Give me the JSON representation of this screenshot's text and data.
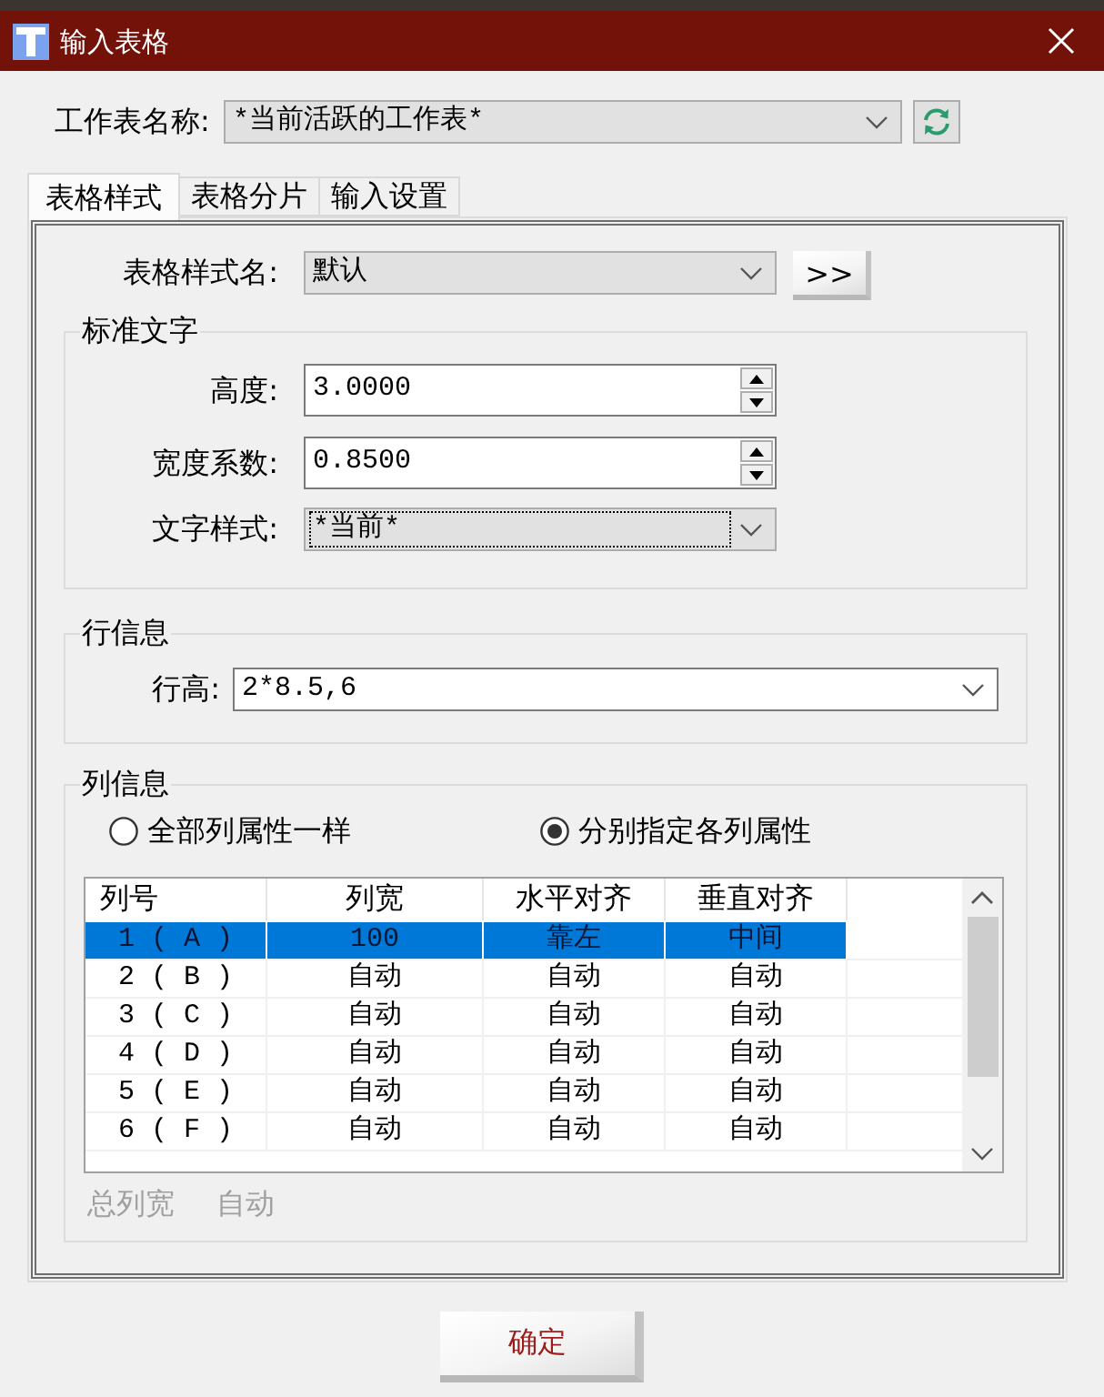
{
  "window": {
    "title": "输入表格"
  },
  "worksheet": {
    "label": "工作表名称:",
    "value": "*当前活跃的工作表*"
  },
  "tabs": [
    {
      "label": "表格样式",
      "selected": true
    },
    {
      "label": "表格分片",
      "selected": false
    },
    {
      "label": "输入设置",
      "selected": false
    }
  ],
  "table_style": {
    "label": "表格样式名:",
    "value": "默认",
    "button": ">>"
  },
  "standard_text": {
    "title": "标准文字",
    "fields": [
      {
        "kind": "spin",
        "label": "高度:",
        "value": "3.0000",
        "focused": false
      },
      {
        "kind": "spin",
        "label": "宽度系数:",
        "value": "0.8500",
        "focused": false
      },
      {
        "kind": "dropdown",
        "label": "文字样式:",
        "value": "*当前*",
        "focused": true
      }
    ]
  },
  "row_info": {
    "title": "行信息",
    "label": "行高:",
    "value": "2*8.5,6"
  },
  "column_info": {
    "title": "列信息",
    "options": [
      {
        "label": "全部列属性一样",
        "selected": false
      },
      {
        "label": "分别指定各列属性",
        "selected": true
      }
    ],
    "table": {
      "columns": [
        "列号",
        "列宽",
        "水平对齐",
        "垂直对齐"
      ],
      "rows": [
        {
          "cells": [
            "1 ( A )",
            "100",
            "靠左",
            "中间"
          ],
          "selected": true
        },
        {
          "cells": [
            "2 ( B )",
            "自动",
            "自动",
            "自动"
          ],
          "selected": false
        },
        {
          "cells": [
            "3 ( C )",
            "自动",
            "自动",
            "自动"
          ],
          "selected": false
        },
        {
          "cells": [
            "4 ( D )",
            "自动",
            "自动",
            "自动"
          ],
          "selected": false
        },
        {
          "cells": [
            "5 ( E )",
            "自动",
            "自动",
            "自动"
          ],
          "selected": false
        },
        {
          "cells": [
            "6 ( F )",
            "自动",
            "自动",
            "自动"
          ],
          "selected": false
        }
      ]
    },
    "total_width": {
      "label": "总列宽",
      "value": "自动",
      "disabled": true
    }
  },
  "buttons": [
    {
      "label": "确定"
    }
  ]
}
